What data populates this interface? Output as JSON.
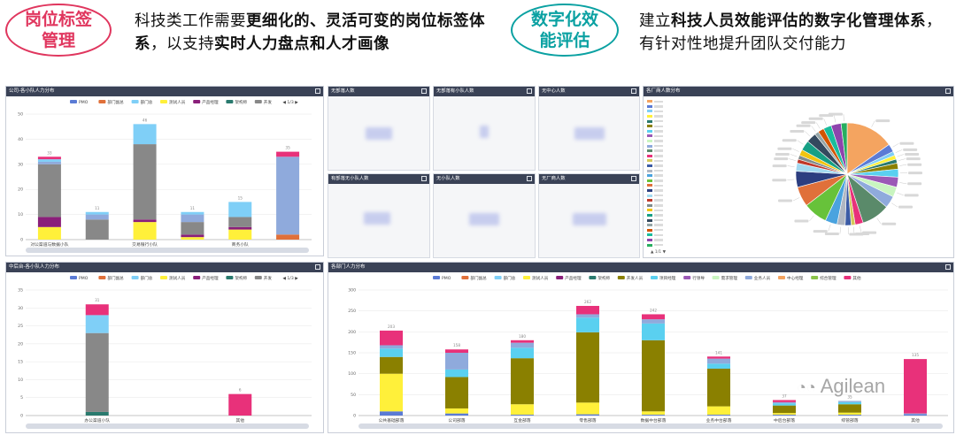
{
  "header": {
    "left_badge": "岗位标签管理",
    "left_text": [
      {
        "t": "科技类工作需要",
        "b": false
      },
      {
        "t": "更细化的、灵活可变的岗位标签体系",
        "b": true
      },
      {
        "t": "，以支持",
        "b": false
      },
      {
        "t": "实时人力盘点和人才画像",
        "b": true
      }
    ],
    "right_badge": "数字化效能评估",
    "right_text": [
      {
        "t": "建立",
        "b": false
      },
      {
        "t": "科技人员效能评估的数字化管理体系",
        "b": true
      },
      {
        "t": "，有针对性地提升团队交付能力",
        "b": false
      }
    ],
    "left_color": "#e0365e",
    "right_color": "#0aa1a2"
  },
  "panels": {
    "p1_title": "公司-各小队人力分布",
    "p2_title": "中后台-各小队人力分布",
    "p3_title": "各部门人力分布",
    "kpi1_title": "无部落人数",
    "kpi2_title": "无部落有小队人数",
    "kpi3_title": "无中心人数",
    "kpi4_title": "有部落无小队人数",
    "kpi5_title": "无小队人数",
    "kpi6_title": "无厂商人数",
    "pie_title": "各厂商人数分布",
    "pie_pager": "▲ 1/1 ▼"
  },
  "legend_pager": "1/3",
  "watermark": "Agilean",
  "colors": {
    "PMO": "#5b7bd5",
    "部门副总": "#e0703a",
    "部门总": "#7fcff7",
    "测试人员": "#fff03a",
    "产品经理": "#8a1f7a",
    "架构师": "#2a7a6e",
    "开发人员": "#8a8000",
    "项目经理": "#5ad0f0",
    "行领导": "#9b59b6",
    "需求管理": "#c9f5c0",
    "业务人员": "#8faadc",
    "中心经理": "#f4a460",
    "综合管理": "#8bc34a",
    "其他": "#e8317a"
  },
  "chart_data": [
    {
      "type": "bar",
      "title": "公司-各小队人力分布",
      "legend": [
        "PMO",
        "部门副总",
        "部门总",
        "测试人员",
        "产品经理",
        "架构师",
        "开发"
      ],
      "categories": [
        "对公渠道与数据小队",
        "",
        "交易银行小队",
        "",
        "商务小队",
        ""
      ],
      "shown_labels": [
        "对公渠道与数据小队",
        "交易银行小队",
        "商务小队"
      ],
      "ylim": [
        0,
        50
      ],
      "yticks": [
        0,
        10,
        20,
        30,
        40,
        50
      ],
      "series": [
        {
          "name": "测试人员",
          "values": [
            5,
            0,
            7,
            1,
            4,
            0
          ]
        },
        {
          "name": "产品经理",
          "values": [
            4,
            0,
            1,
            1,
            1,
            0
          ]
        },
        {
          "name": "开发",
          "values": [
            21,
            8,
            30,
            5,
            4,
            0
          ]
        },
        {
          "name": "部门副总",
          "values": [
            0,
            0,
            0,
            0,
            0,
            2
          ]
        },
        {
          "name": "业务人员",
          "values": [
            1,
            2,
            0,
            3,
            0,
            31
          ]
        },
        {
          "name": "部门总",
          "values": [
            1,
            1,
            8,
            1,
            6,
            0
          ]
        },
        {
          "name": "其他",
          "values": [
            1,
            0,
            0,
            0,
            0,
            2
          ]
        }
      ]
    },
    {
      "type": "bar",
      "title": "中后台-各小队人力分布",
      "legend": [
        "PMO",
        "部门副总",
        "部门总",
        "测试人员",
        "产品经理",
        "架构师",
        "开发"
      ],
      "categories": [
        "办公渠道小队",
        "其他"
      ],
      "ylim": [
        0,
        35
      ],
      "yticks": [
        0,
        5,
        10,
        15,
        20,
        25,
        30,
        35
      ],
      "series": [
        {
          "name": "架构师",
          "values": [
            1,
            0
          ]
        },
        {
          "name": "开发",
          "values": [
            22,
            0
          ]
        },
        {
          "name": "部门总",
          "values": [
            5,
            0
          ]
        },
        {
          "name": "其他",
          "values": [
            3,
            6
          ]
        }
      ]
    },
    {
      "type": "bar",
      "title": "各部门人力分布",
      "legend": [
        "PMO",
        "部门副总",
        "部门总",
        "测试人员",
        "产品经理",
        "架构师",
        "开发人员",
        "项目经理",
        "行领导",
        "需求管理",
        "业务人员",
        "中心经理",
        "综合管理",
        "其他"
      ],
      "categories": [
        "公共基础部落",
        "公司部落",
        "互金部落",
        "零售部落",
        "数据中台部落",
        "业务中台部落",
        "中后台部落",
        "综管部落",
        "其他"
      ],
      "ylim": [
        0,
        300
      ],
      "yticks": [
        0,
        50,
        100,
        150,
        200,
        250,
        300
      ],
      "series": [
        {
          "name": "PMO",
          "values": [
            10,
            5,
            2,
            3,
            2,
            2,
            2,
            2,
            3
          ]
        },
        {
          "name": "测试人员",
          "values": [
            90,
            12,
            25,
            28,
            8,
            20,
            4,
            5,
            0
          ]
        },
        {
          "name": "开发人员",
          "values": [
            40,
            75,
            110,
            168,
            170,
            90,
            18,
            20,
            0
          ]
        },
        {
          "name": "项目经理",
          "values": [
            20,
            18,
            25,
            35,
            40,
            12,
            5,
            5,
            0
          ]
        },
        {
          "name": "业务人员",
          "values": [
            8,
            40,
            12,
            8,
            10,
            12,
            3,
            3,
            2
          ]
        },
        {
          "name": "其他",
          "values": [
            35,
            8,
            6,
            20,
            12,
            5,
            5,
            0,
            130
          ]
        }
      ]
    },
    {
      "type": "pie",
      "title": "各厂商人数分布",
      "values": [
        24,
        4,
        2,
        2,
        2,
        3,
        4,
        5,
        5,
        6,
        14,
        4,
        2,
        3,
        4,
        6,
        12,
        10,
        8,
        4,
        2,
        2,
        3,
        5,
        5,
        2,
        3,
        4,
        5,
        3
      ]
    }
  ]
}
